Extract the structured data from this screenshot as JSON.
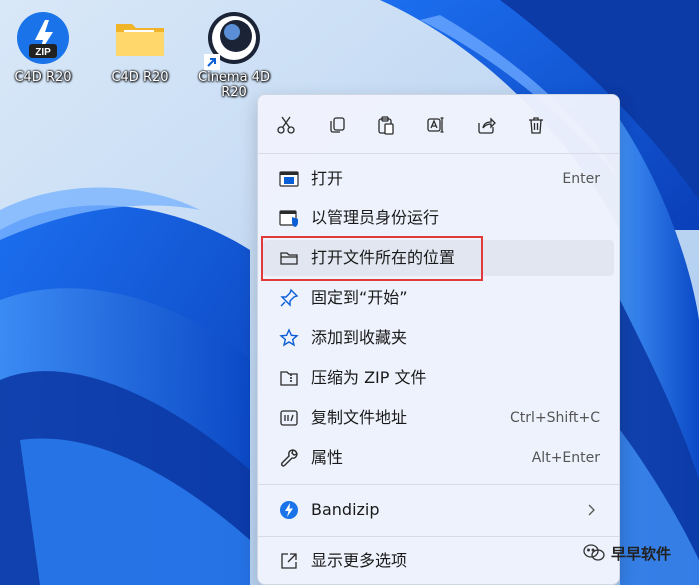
{
  "desktop": {
    "icons": [
      {
        "label": "C4D R20",
        "type": "zip-archive"
      },
      {
        "label": "C4D R20",
        "type": "folder"
      },
      {
        "label": "Cinema 4D\nR20",
        "type": "cinema4d-shortcut"
      }
    ]
  },
  "context_menu": {
    "toolbar": [
      "cut",
      "copy",
      "paste",
      "rename",
      "share",
      "delete"
    ],
    "items": [
      {
        "label": "打开",
        "shortcut": "Enter",
        "icon": "open-app-icon"
      },
      {
        "label": "以管理员身份运行",
        "shortcut": "",
        "icon": "shield-icon"
      },
      {
        "label": "打开文件所在的位置",
        "shortcut": "",
        "icon": "folder-icon",
        "highlighted": true
      },
      {
        "label": "固定到“开始”",
        "shortcut": "",
        "icon": "pin-icon"
      },
      {
        "label": "添加到收藏夹",
        "shortcut": "",
        "icon": "star-icon"
      },
      {
        "label": "压缩为 ZIP 文件",
        "shortcut": "",
        "icon": "zip-icon"
      },
      {
        "label": "复制文件地址",
        "shortcut": "Ctrl+Shift+C",
        "icon": "copy-path-icon"
      },
      {
        "label": "属性",
        "shortcut": "Alt+Enter",
        "icon": "wrench-icon"
      },
      {
        "label": "Bandizip",
        "shortcut": "",
        "icon": "bandizip-icon",
        "submenu": true
      },
      {
        "label": "显示更多选项",
        "shortcut": "",
        "icon": "more-options-icon"
      }
    ]
  },
  "watermark": {
    "text": "早早软件"
  },
  "colors": {
    "accent": "#0a5fd6",
    "highlight_border": "#e03a3a",
    "menu_bg": "#eff3fc"
  }
}
